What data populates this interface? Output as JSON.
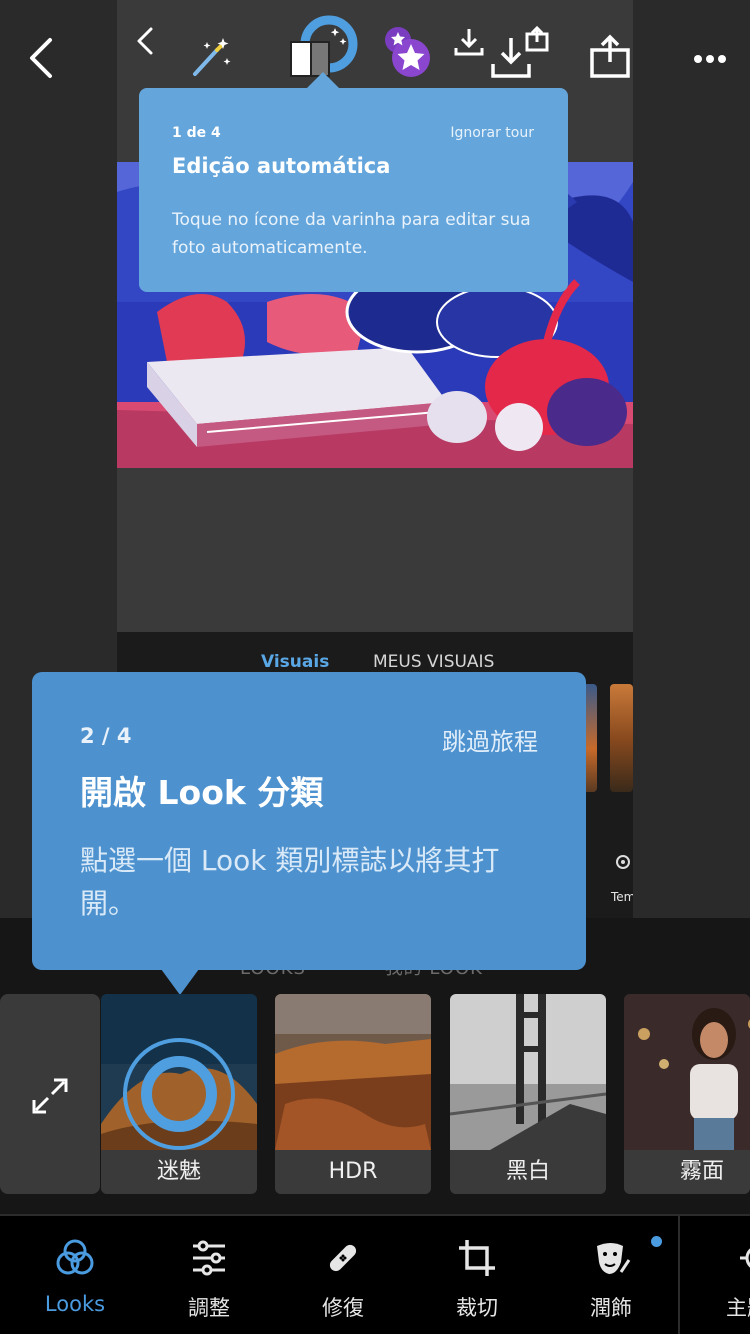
{
  "tour_step1": {
    "step": "1 de 4",
    "skip": "Ignorar tour",
    "title": "Edição automática",
    "body": "Toque no ícone da varinha para editar sua foto automaticamente."
  },
  "inner_tabs": {
    "active": "Visuais",
    "inactive": "MEUS VISUAIS"
  },
  "inner_partial_label": "Tem",
  "tour_step2": {
    "step": "2 / 4",
    "skip": "跳過旅程",
    "title": "開啟 Look 分類",
    "body": "點選一個 Look 類別標誌以將其打開。"
  },
  "looks_tabs": {
    "first": "LOOKS",
    "second": "我的 LOOK"
  },
  "looks": [
    {
      "label": "迷魅"
    },
    {
      "label": "HDR"
    },
    {
      "label": "黑白"
    },
    {
      "label": "霧面"
    }
  ],
  "nav": [
    {
      "label": "Looks",
      "icon": "looks-icon",
      "active": true
    },
    {
      "label": "調整",
      "icon": "sliders-icon"
    },
    {
      "label": "修復",
      "icon": "bandage-icon"
    },
    {
      "label": "裁切",
      "icon": "crop-icon"
    },
    {
      "label": "潤飾",
      "icon": "face-retouch-icon"
    },
    {
      "label": "主題",
      "icon": "theme-icon"
    }
  ],
  "colors": {
    "accent": "#4a9be0",
    "tooltip_small": "#64a6dc",
    "tooltip_large": "#4d92cf"
  }
}
